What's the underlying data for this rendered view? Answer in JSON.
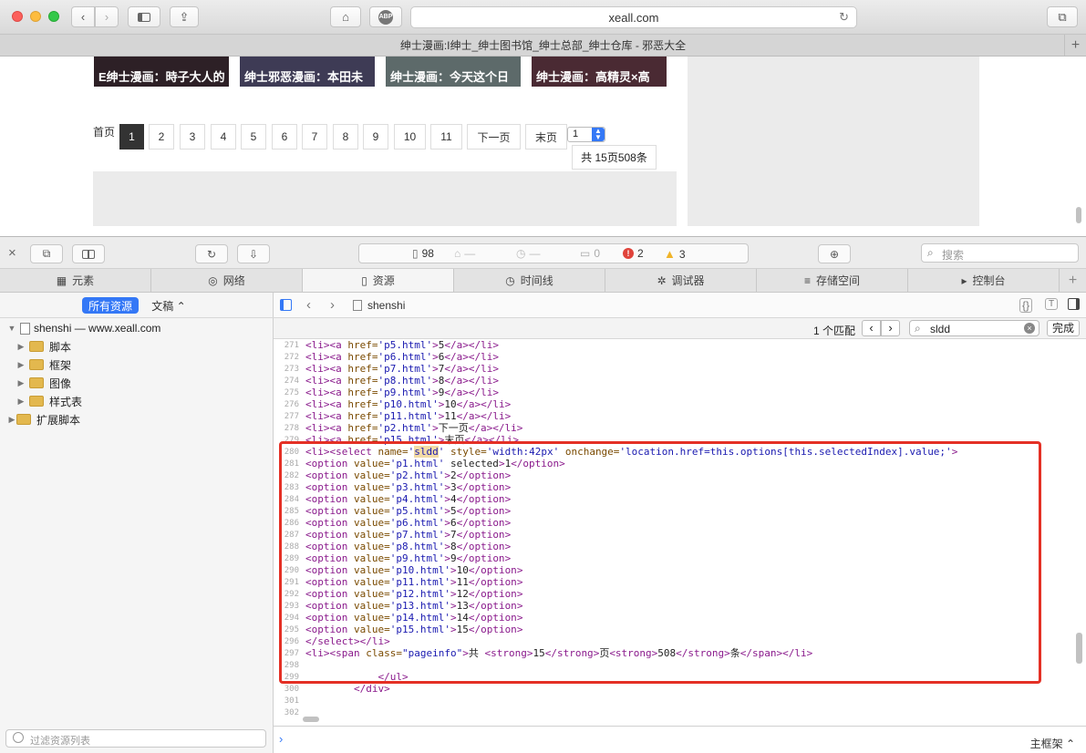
{
  "browser": {
    "url": "xeall.com",
    "tab_title": "绅士漫画:​​​I绅士_绅士图书馆_绅士总部_绅士仓库 - 邪恶大全",
    "abp_label": "ABP"
  },
  "page": {
    "thumbs": [
      "E绅士漫画：時子大人的",
      "绅士邪恶漫画：本田未",
      "绅士漫画：今天这个日",
      "绅士漫画：高精灵×高"
    ],
    "pager": {
      "first_label": "首页",
      "pages": [
        "1",
        "2",
        "3",
        "4",
        "5",
        "6",
        "7",
        "8",
        "9",
        "10",
        "11"
      ],
      "next_label": "下一页",
      "last_label": "末页",
      "select_value": "1",
      "info": "共 15页508条"
    }
  },
  "inspector": {
    "status": {
      "resources": "98",
      "requests": "—",
      "time": "—",
      "logs": "0",
      "errors": "2",
      "warnings": "3"
    },
    "search_placeholder": "搜索",
    "tabs": [
      "元素",
      "网络",
      "资源",
      "时间线",
      "调试器",
      "存储空间",
      "控制台"
    ],
    "selected_tab": "资源",
    "sidebar": {
      "all_resources": "所有资源",
      "documents": "文稿 ⌃",
      "root": "shenshi — www.xeall.com",
      "folders": [
        "脚本",
        "框架",
        "图像",
        "样式表"
      ],
      "ext": "扩展脚本",
      "filter_placeholder": "过滤资源列表"
    },
    "breadcrumb": "shenshi",
    "find": {
      "count": "1 个匹配",
      "query": "sldd",
      "done": "完成"
    },
    "frame_label": "主框架 ⌃",
    "code_lines": [
      {
        "n": "271",
        "t": "<li><a href='p5.html'>5</a></li>"
      },
      {
        "n": "272",
        "t": "<li><a href='p6.html'>6</a></li>"
      },
      {
        "n": "273",
        "t": "<li><a href='p7.html'>7</a></li>"
      },
      {
        "n": "274",
        "t": "<li><a href='p8.html'>8</a></li>"
      },
      {
        "n": "275",
        "t": "<li><a href='p9.html'>9</a></li>"
      },
      {
        "n": "276",
        "t": "<li><a href='p10.html'>10</a></li>"
      },
      {
        "n": "277",
        "t": "<li><a href='p11.html'>11</a></li>"
      },
      {
        "n": "278",
        "t": "<li><a href='p2.html'>下一页</a></li>"
      },
      {
        "n": "279",
        "t": "<li><a href='p15.html'>末页</a></li>"
      },
      {
        "n": "280",
        "t": "<li><select name='sldd' style='width:42px' onchange='location.href=this.options[this.selectedIndex].value;'>"
      },
      {
        "n": "281",
        "t": "<option value='p1.html' selected>1</option>"
      },
      {
        "n": "282",
        "t": "<option value='p2.html'>2</option>"
      },
      {
        "n": "283",
        "t": "<option value='p3.html'>3</option>"
      },
      {
        "n": "284",
        "t": "<option value='p4.html'>4</option>"
      },
      {
        "n": "285",
        "t": "<option value='p5.html'>5</option>"
      },
      {
        "n": "286",
        "t": "<option value='p6.html'>6</option>"
      },
      {
        "n": "287",
        "t": "<option value='p7.html'>7</option>"
      },
      {
        "n": "288",
        "t": "<option value='p8.html'>8</option>"
      },
      {
        "n": "289",
        "t": "<option value='p9.html'>9</option>"
      },
      {
        "n": "290",
        "t": "<option value='p10.html'>10</option>"
      },
      {
        "n": "291",
        "t": "<option value='p11.html'>11</option>"
      },
      {
        "n": "292",
        "t": "<option value='p12.html'>12</option>"
      },
      {
        "n": "293",
        "t": "<option value='p13.html'>13</option>"
      },
      {
        "n": "294",
        "t": "<option value='p14.html'>14</option>"
      },
      {
        "n": "295",
        "t": "<option value='p15.html'>15</option>"
      },
      {
        "n": "296",
        "t": "</select></li>"
      },
      {
        "n": "297",
        "t": "<li><span class=\"pageinfo\">共 <strong>15</strong>页<strong>508</strong>条</span></li>"
      },
      {
        "n": "298",
        "t": ""
      },
      {
        "n": "299",
        "t": "            </ul>"
      },
      {
        "n": "300",
        "t": "        </div>"
      },
      {
        "n": "301",
        "t": ""
      },
      {
        "n": "302",
        "t": ""
      }
    ]
  },
  "colors": {
    "accent": "#3478f6",
    "highlight_box": "#e43025",
    "error": "#e0433b",
    "warning": "#f0b429"
  }
}
